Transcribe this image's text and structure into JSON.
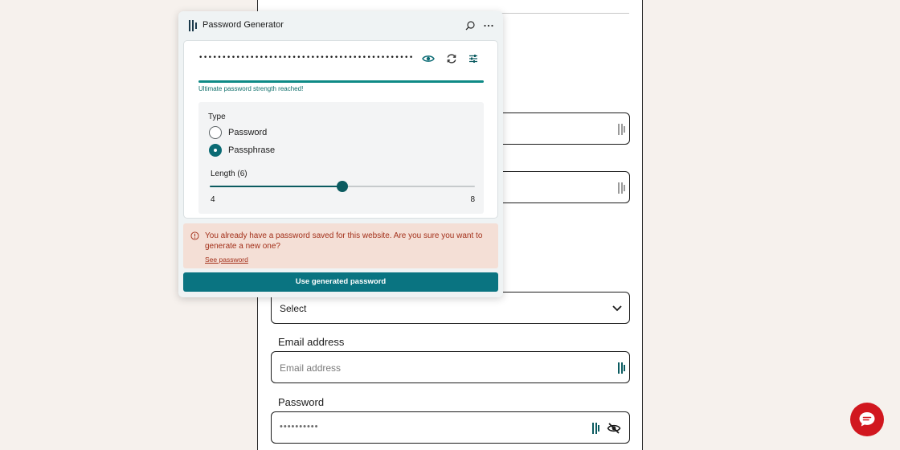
{
  "popup": {
    "title": "Password Generator",
    "header_icons": [
      "search-icon",
      "more-icon"
    ],
    "password_masked": "••••••••••••••••••••••••••••••••••••••••••••••••••••",
    "action_icons": [
      "eye-icon",
      "refresh-icon",
      "settings-sliders-icon"
    ],
    "strength": {
      "level": 1.0,
      "text": "Ultimate password strength reached!",
      "color": "#0e8a86"
    },
    "options": {
      "type_label": "Type",
      "types": [
        {
          "label": "Password",
          "checked": false
        },
        {
          "label": "Passphrase",
          "checked": true
        }
      ],
      "length_label": "Length (6)",
      "length": {
        "min": 4,
        "max": 8,
        "value": 6,
        "min_label": "4",
        "max_label": "8"
      }
    },
    "warning": {
      "icon": "info-circle-icon",
      "text": "You already have a password saved for this website. Are you sure you want to generate a new one?",
      "link": "See password"
    },
    "use_button": "Use generated password"
  },
  "form": {
    "select_value": "Select",
    "email_label": "Email address",
    "email_placeholder": "Email address",
    "password_label": "Password",
    "password_masked": "••••••••••"
  },
  "colors": {
    "accent": "#0a7481",
    "warning_bg": "#f4dfd6",
    "warning_text": "#a3301a",
    "chat_button": "#d1171f"
  }
}
